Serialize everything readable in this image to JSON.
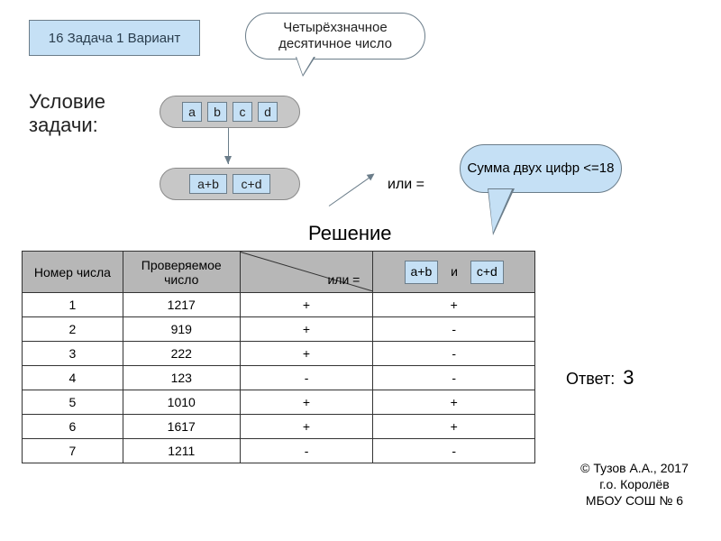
{
  "title": "16 Задача 1 Вариант",
  "callout_top": "Четырёхзначное десятичное число",
  "condition_label": "Условие задачи:",
  "digits": [
    "a",
    "b",
    "c",
    "d"
  ],
  "sums": [
    "a+b",
    "c+d"
  ],
  "or_eq": "или =",
  "solution_label": "Решение",
  "callout_sum": "Сумма двух цифр <=18",
  "table": {
    "headers": {
      "num": "Номер числа",
      "checked": "Проверяемое число",
      "or_eq": "или  =",
      "ab": "a+b",
      "cd": "c+d",
      "and": "и"
    },
    "rows": [
      {
        "n": "1",
        "v": "1217",
        "c1": "+",
        "c2": "+"
      },
      {
        "n": "2",
        "v": "919",
        "c1": "+",
        "c2": "-"
      },
      {
        "n": "3",
        "v": "222",
        "c1": "+",
        "c2": "-"
      },
      {
        "n": "4",
        "v": "123",
        "c1": "-",
        "c2": "-"
      },
      {
        "n": "5",
        "v": "1010",
        "c1": "+",
        "c2": "+"
      },
      {
        "n": "6",
        "v": "1617",
        "c1": "+",
        "c2": "+"
      },
      {
        "n": "7",
        "v": "1211",
        "c1": "-",
        "c2": "-"
      }
    ]
  },
  "answer_label": "Ответ:",
  "answer_value": "3",
  "credit": "© Тузов А.А., 2017\nг.о. Королёв\nМБОУ СОШ № 6",
  "chart_data": {
    "type": "table",
    "title": "Проверка чисел",
    "columns": [
      "Номер числа",
      "Проверяемое число",
      "или =",
      "a+b и c+d"
    ],
    "rows": [
      [
        1,
        1217,
        "+",
        "+"
      ],
      [
        2,
        919,
        "+",
        "-"
      ],
      [
        3,
        222,
        "+",
        "-"
      ],
      [
        4,
        123,
        "-",
        "-"
      ],
      [
        5,
        1010,
        "+",
        "+"
      ],
      [
        6,
        1617,
        "+",
        "+"
      ],
      [
        7,
        1211,
        "-",
        "-"
      ]
    ],
    "answer": 3
  }
}
